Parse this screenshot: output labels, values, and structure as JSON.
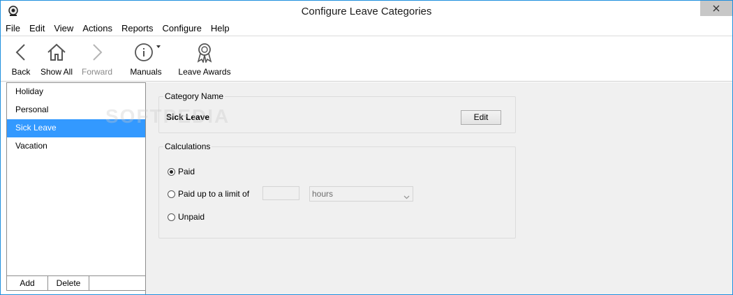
{
  "window": {
    "title": "Configure Leave Categories"
  },
  "menu": [
    "File",
    "Edit",
    "View",
    "Actions",
    "Reports",
    "Configure",
    "Help"
  ],
  "toolbar": {
    "back": "Back",
    "show_all": "Show All",
    "forward": "Forward",
    "manuals": "Manuals",
    "leave_awards": "Leave Awards"
  },
  "categories": {
    "items": [
      "Holiday",
      "Personal",
      "Sick Leave",
      "Vacation"
    ],
    "selected": "Sick Leave",
    "add_label": "Add",
    "delete_label": "Delete"
  },
  "category_name": {
    "group_label": "Category Name",
    "value": "Sick Leave",
    "edit_label": "Edit"
  },
  "calculations": {
    "group_label": "Calculations",
    "options": [
      "Paid",
      "Paid up to a limit of",
      "Unpaid"
    ],
    "selected": "Paid",
    "limit_value": "",
    "unit_selected": "hours"
  },
  "watermark": "SOFTPEDIA",
  "colors": {
    "selection": "#3399ff",
    "accent_border": "#1e8fde",
    "panel_bg": "#f0f0f0"
  }
}
